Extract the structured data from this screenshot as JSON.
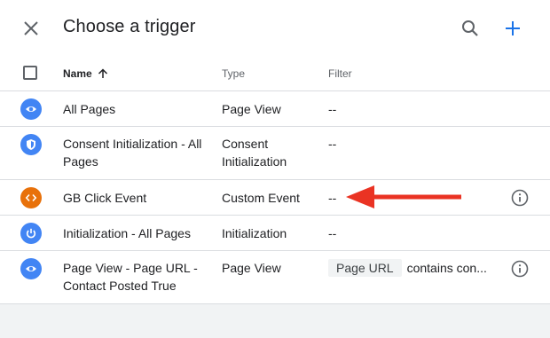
{
  "header": {
    "title": "Choose a trigger",
    "close_icon": "close-icon",
    "search_icon": "search-icon",
    "add_icon": "add-icon"
  },
  "table": {
    "columns": {
      "name": "Name",
      "type": "Type",
      "filter": "Filter"
    },
    "sort_icon": "arrow-up-icon",
    "rows": [
      {
        "name": "All Pages",
        "type": "Page View",
        "filter": "--",
        "icon": "eye-icon",
        "icon_color": "#4285f4"
      },
      {
        "name": "Consent Initialization - All Pages",
        "type": "Consent Initialization",
        "filter": "--",
        "icon": "shield-icon",
        "icon_color": "#4285f4"
      },
      {
        "name": "GB Click Event",
        "type": "Custom Event",
        "filter": "--",
        "icon": "code-icon",
        "icon_color": "#e8710a"
      },
      {
        "name": "Initialization - All Pages",
        "type": "Initialization",
        "filter": "--",
        "icon": "power-icon",
        "icon_color": "#4285f4"
      },
      {
        "name": "Page View - Page URL - Contact Posted True",
        "type": "Page View",
        "filter_chip": "Page URL",
        "filter_text": "contains con...",
        "icon": "eye-icon",
        "icon_color": "#4285f4"
      }
    ]
  },
  "colors": {
    "accent_blue": "#1a73e8",
    "icon_blue": "#4285f4",
    "icon_orange": "#e8710a",
    "arrow_red": "#ea3323"
  }
}
